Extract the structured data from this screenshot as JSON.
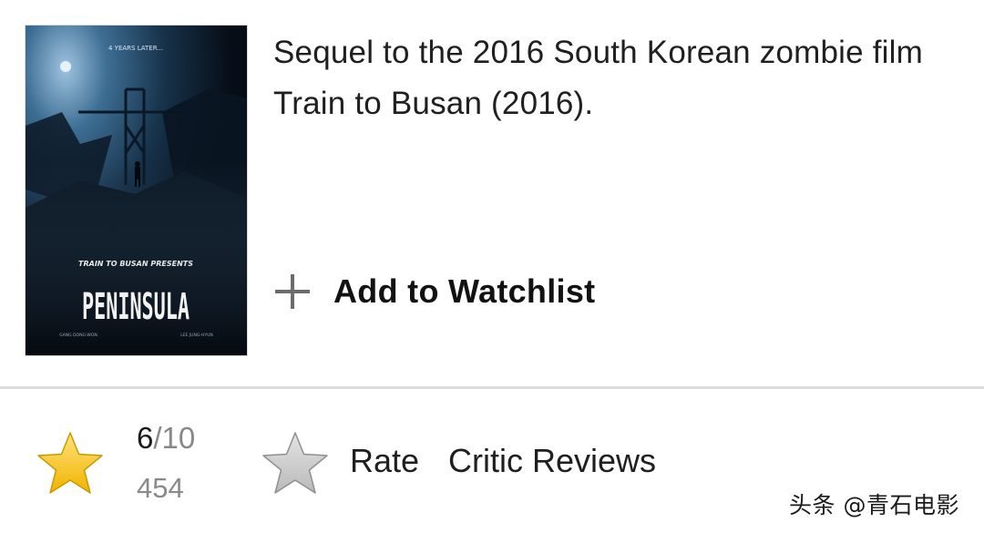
{
  "movie": {
    "poster": {
      "tagline": "4 YEARS LATER...",
      "presenter": "TRAIN TO BUSAN PRESENTS",
      "title": "PENINSULA",
      "credit_left": "GANG DONG-WON",
      "credit_right": "LEE JUNG-HYUN"
    },
    "description": "Sequel to the 2016 South Korean zombie film Train to Busan (2016).",
    "watchlist_label": "Add to Watchlist"
  },
  "ratings": {
    "score": "6",
    "score_out_of": "/10",
    "vote_count": "454",
    "rate_label": "Rate",
    "critic_reviews_label": "Critic Reviews"
  },
  "icons": {
    "rated_star": "star-icon",
    "rate_star": "star-outline-icon",
    "watchlist": "plus-icon"
  },
  "colors": {
    "star_gold": "#f5c518",
    "star_grey": "#c7c7c7",
    "divider": "#dcdcdc"
  },
  "watermark": "头条 @青石电影"
}
